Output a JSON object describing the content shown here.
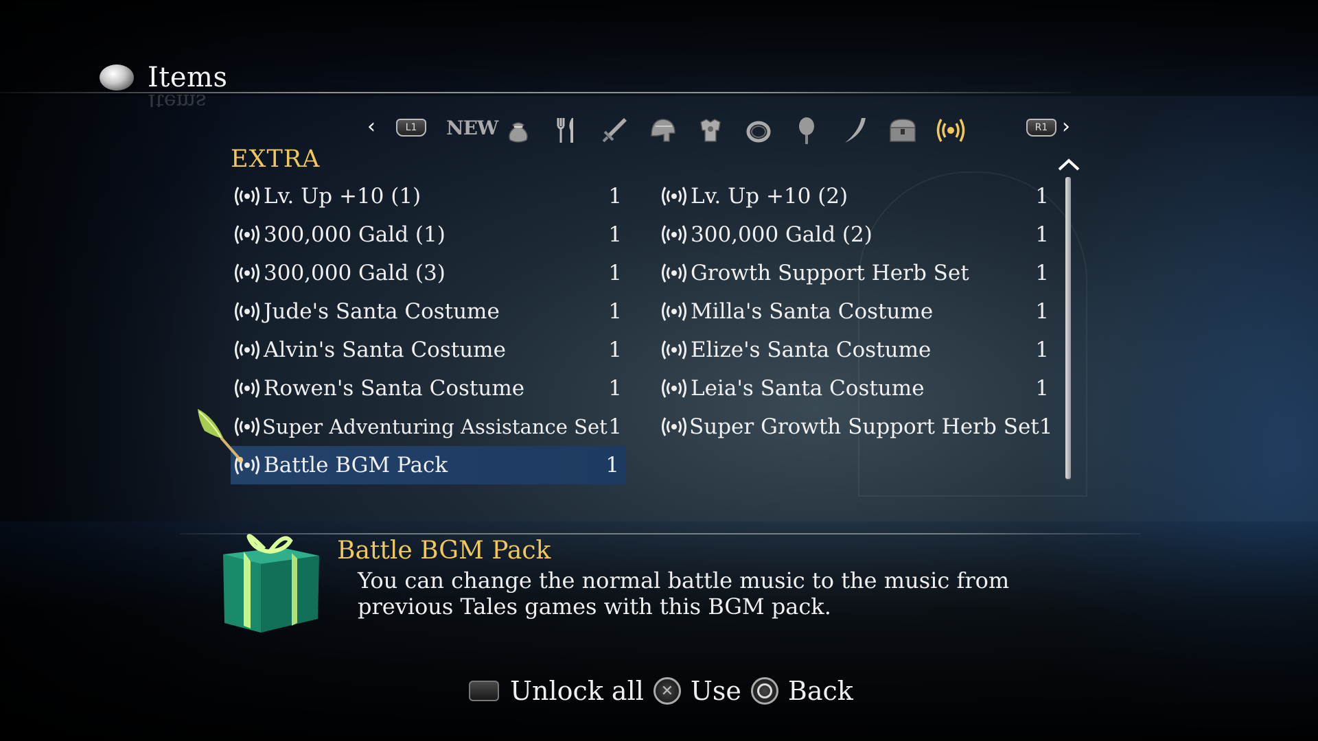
{
  "header": {
    "title": "Items"
  },
  "categories": {
    "prev_button": "L1",
    "next_button": "R1",
    "new_label": "NEW",
    "icons": [
      "bag-icon",
      "cutlery-icon",
      "sword-icon",
      "helmet-icon",
      "armor-icon",
      "ring-icon",
      "jewel-icon",
      "horn-icon",
      "treasure-chest-icon",
      "extra-signal-icon"
    ],
    "active": "extra-signal-icon",
    "active_color": "#f2c85a"
  },
  "section": {
    "title": "EXTRA"
  },
  "items_left": [
    {
      "name": "Lv. Up +10 (1)",
      "qty": "1"
    },
    {
      "name": "300,000 Gald (1)",
      "qty": "1"
    },
    {
      "name": "300,000 Gald (3)",
      "qty": "1"
    },
    {
      "name": "Jude's Santa Costume",
      "qty": "1"
    },
    {
      "name": "Alvin's Santa Costume",
      "qty": "1"
    },
    {
      "name": "Rowen's Santa Costume",
      "qty": "1"
    },
    {
      "name": "Super Adventuring Assistance Set",
      "qty": "1"
    },
    {
      "name": "Battle BGM Pack",
      "qty": "1"
    }
  ],
  "items_right": [
    {
      "name": "Lv. Up +10 (2)",
      "qty": "1"
    },
    {
      "name": "300,000 Gald (2)",
      "qty": "1"
    },
    {
      "name": "Growth Support Herb Set",
      "qty": "1"
    },
    {
      "name": "Milla's Santa Costume",
      "qty": "1"
    },
    {
      "name": "Elize's Santa Costume",
      "qty": "1"
    },
    {
      "name": "Leia's Santa Costume",
      "qty": "1"
    },
    {
      "name": "Super Growth Support Herb Set",
      "qty": "1"
    }
  ],
  "selected": "Battle BGM Pack",
  "description": {
    "title": "Battle BGM Pack",
    "text": "You can change the normal battle music to the music from previous Tales games with this BGM pack."
  },
  "footer": {
    "unlock_all": "Unlock all",
    "use": "Use",
    "back": "Back"
  },
  "colors": {
    "accent": "#f2c85a",
    "selection": "#23426a"
  }
}
